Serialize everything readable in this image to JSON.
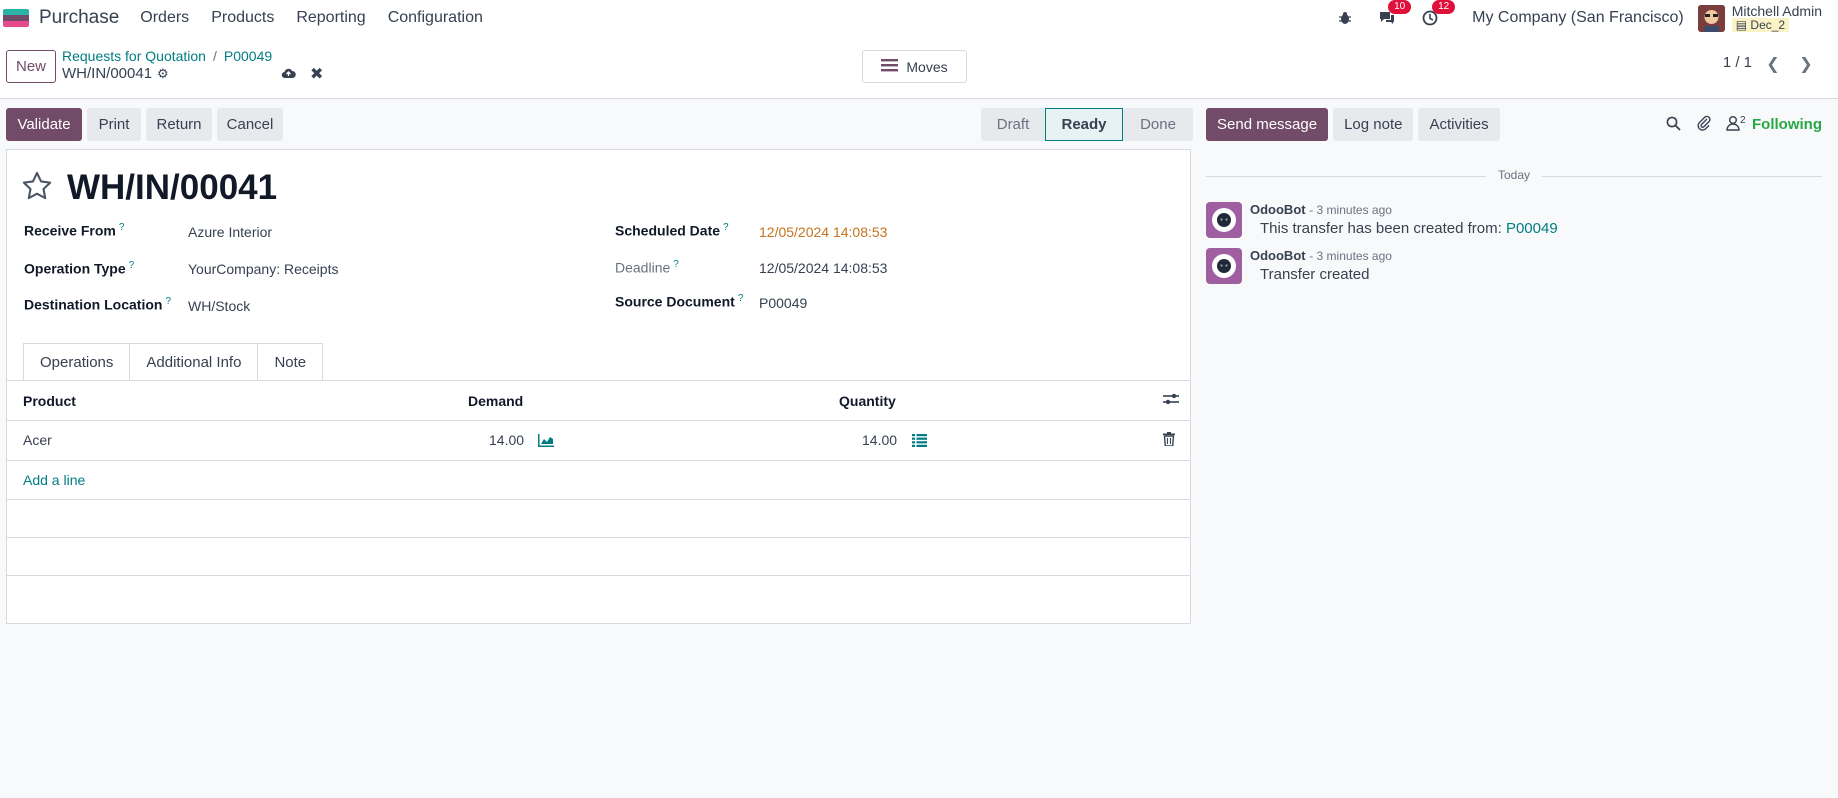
{
  "navbar": {
    "app_name": "Purchase",
    "menus": [
      "Orders",
      "Products",
      "Reporting",
      "Configuration"
    ],
    "messages_count": "10",
    "activities_count": "12",
    "company": "My Company (San Francisco)",
    "user_name": "Mitchell Admin",
    "database": "Dec_2"
  },
  "control_panel": {
    "new_label": "New",
    "breadcrumb": [
      "Requests for Quotation",
      "P00049"
    ],
    "record_name": "WH/IN/00041",
    "moves_label": "Moves",
    "pager": "1 / 1"
  },
  "actions": {
    "validate": "Validate",
    "print": "Print",
    "return": "Return",
    "cancel": "Cancel"
  },
  "statusbar": {
    "stages": [
      "Draft",
      "Ready",
      "Done"
    ],
    "active": "Ready"
  },
  "form": {
    "title": "WH/IN/00041",
    "receive_from_label": "Receive From",
    "receive_from": "Azure Interior",
    "operation_type_label": "Operation Type",
    "operation_type": "YourCompany: Receipts",
    "destination_label": "Destination Location",
    "destination": "WH/Stock",
    "scheduled_date_label": "Scheduled Date",
    "scheduled_date": "12/05/2024 14:08:53",
    "deadline_label": "Deadline",
    "deadline": "12/05/2024 14:08:53",
    "source_document_label": "Source Document",
    "source_document": "P00049",
    "help_mark": "?"
  },
  "tabs": [
    "Operations",
    "Additional Info",
    "Note"
  ],
  "operations": {
    "columns": [
      "Product",
      "Demand",
      "Quantity"
    ],
    "rows": [
      {
        "product": "Acer",
        "demand": "14.00",
        "quantity": "14.00"
      }
    ],
    "add_line": "Add a line"
  },
  "chatter": {
    "send_message": "Send message",
    "log_note": "Log note",
    "activities": "Activities",
    "followers_count": "2",
    "following": "Following",
    "today": "Today",
    "messages": [
      {
        "author": "OdooBot",
        "time": "- 3 minutes ago",
        "body": "This transfer has been created from:",
        "link": "P00049"
      },
      {
        "author": "OdooBot",
        "time": "- 3 minutes ago",
        "body": "Transfer created",
        "link": ""
      }
    ]
  },
  "colors": {
    "brand": "#714b67",
    "link": "#017e84",
    "warning_date": "#c5731c",
    "badge": "#e0103a",
    "following": "#28a745"
  }
}
